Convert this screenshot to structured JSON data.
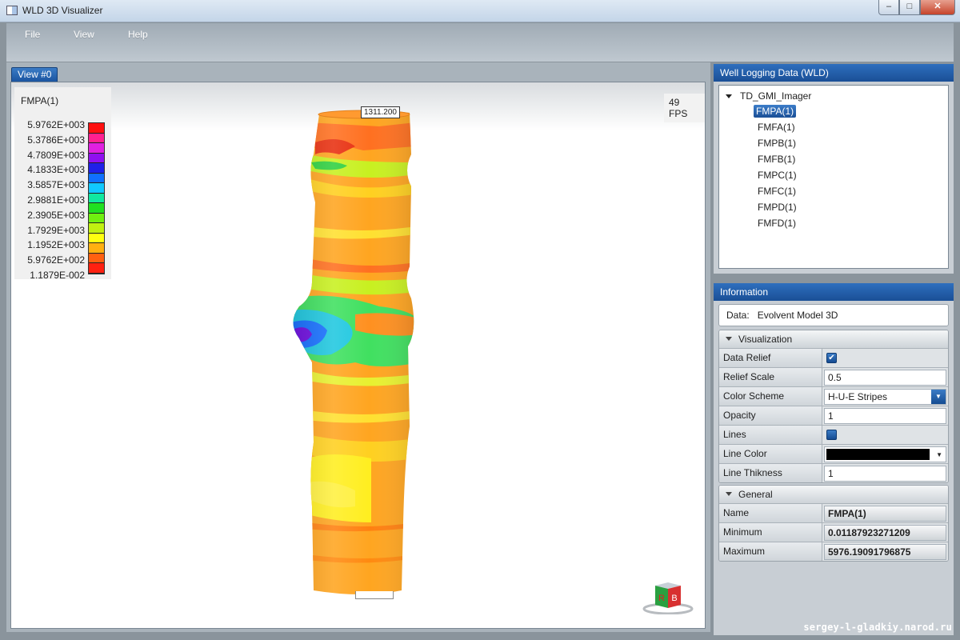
{
  "window": {
    "title": "WLD 3D Visualizer",
    "min": "–",
    "max": "□",
    "close": "✕"
  },
  "menu": {
    "file": "File",
    "view": "View",
    "help": "Help"
  },
  "view": {
    "tab_label": "View #0",
    "fps": "49 FPS",
    "depth_label": "1311.200",
    "legend": {
      "title": "FMPA(1)",
      "labels": [
        "5.9762E+003",
        "5.3786E+003",
        "4.7809E+003",
        "4.1833E+003",
        "3.5857E+003",
        "2.9881E+003",
        "2.3905E+003",
        "1.7929E+003",
        "1.1952E+003",
        "5.9762E+002",
        "1.1879E-002"
      ],
      "colors": [
        "#ff1010",
        "#ff2090",
        "#e020e0",
        "#9010f0",
        "#2020e8",
        "#1070ff",
        "#10c8ff",
        "#10e8a0",
        "#20e020",
        "#70f010",
        "#c0f010",
        "#ffff10",
        "#ffb010",
        "#ff6010",
        "#ff2010"
      ]
    },
    "cube": {
      "left_face": "R",
      "right_face": "B"
    }
  },
  "wld_panel": {
    "header": "Well Logging Data (WLD)",
    "root": "TD_GMI_Imager",
    "children": [
      "FMPA(1)",
      "FMFA(1)",
      "FMPB(1)",
      "FMFB(1)",
      "FMPC(1)",
      "FMFC(1)",
      "FMPD(1)",
      "FMFD(1)"
    ],
    "selected_index": 0
  },
  "info_panel": {
    "header": "Information",
    "data_label": "Data:",
    "data_value": "Evolvent Model 3D",
    "visualization": {
      "title": "Visualization",
      "data_relief": {
        "label": "Data Relief",
        "checked": true
      },
      "relief_scale": {
        "label": "Relief Scale",
        "value": "0.5"
      },
      "color_scheme": {
        "label": "Color Scheme",
        "value": "H-U-E Stripes"
      },
      "opacity": {
        "label": "Opacity",
        "value": "1"
      },
      "lines": {
        "label": "Lines",
        "checked": false
      },
      "line_color": {
        "label": "Line Color",
        "value": "#000000"
      },
      "line_thickness": {
        "label": "Line Thikness",
        "value": "1"
      }
    },
    "general": {
      "title": "General",
      "name": {
        "label": "Name",
        "value": "FMPA(1)"
      },
      "minimum": {
        "label": "Minimum",
        "value": "0.01187923271209"
      },
      "maximum": {
        "label": "Maximum",
        "value": "5976.19091796875"
      }
    }
  },
  "footer": {
    "credit": "sergey-l-gladkiy.narod.ru"
  }
}
